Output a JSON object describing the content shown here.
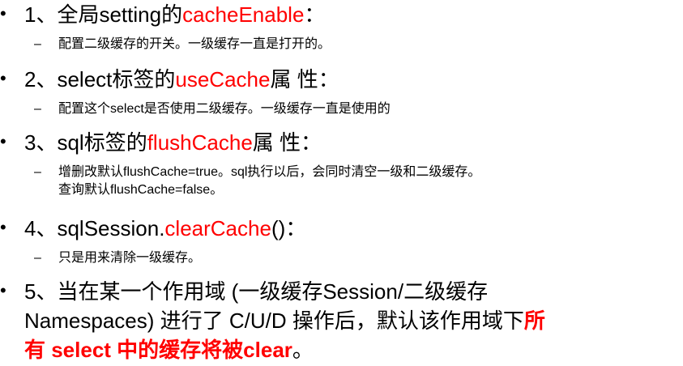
{
  "bullet_glyph": "•",
  "dash_glyph": "–",
  "items": [
    {
      "num": "1、全局setting的",
      "highlight": "cacheEnable",
      "tail": "：",
      "subs": [
        "配置二级缓存的开关。一级缓存一直是打开的。"
      ]
    },
    {
      "num": "2、select标签的",
      "highlight": "useCache",
      "tail": "属 性：",
      "subs": [
        "配置这个select是否使用二级缓存。一级缓存一直是使用的"
      ]
    },
    {
      "num": "3、sql标签的",
      "highlight": "flushCache",
      "tail": "属 性：",
      "subs": [
        "增删改默认flushCache=true。sql执行以后，会同时清空一级和二级缓存。",
        "查询默认flushCache=false。"
      ]
    },
    {
      "num": "4、sqlSession.",
      "highlight": "clearCache",
      "tail": "()：",
      "subs": [
        "只是用来清除一级缓存。"
      ]
    },
    {
      "line1": "5、当在某一个作用域 (一级缓存Session/二级缓存",
      "line2": "Namespaces) 进行了 C/U/D 操作后，默认该作用域下",
      "line2_red": "所",
      "line3_red": "有 select 中的缓存将被clear",
      "line3_tail": "。"
    }
  ]
}
